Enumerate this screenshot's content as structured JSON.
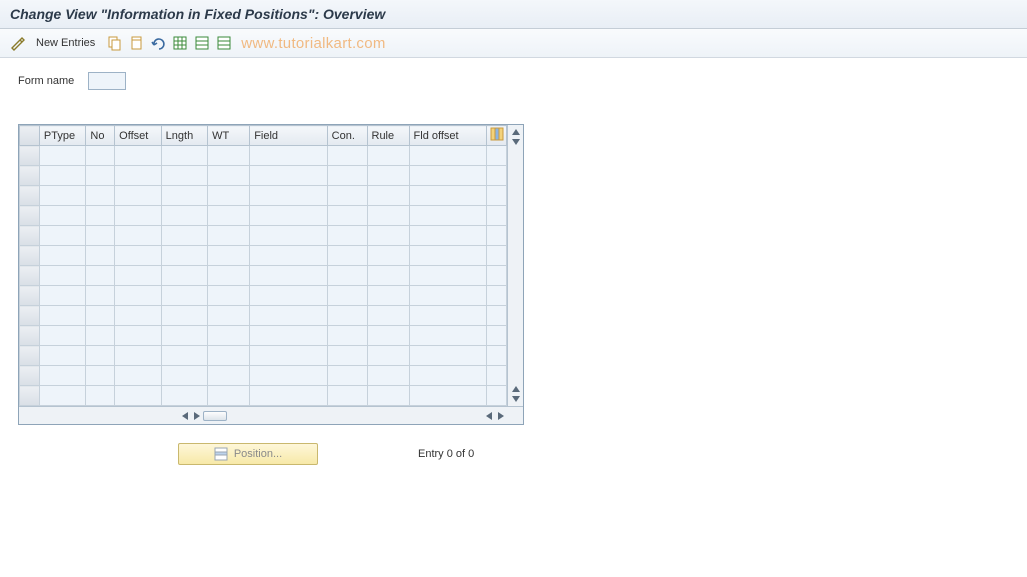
{
  "title": "Change View \"Information in Fixed Positions\": Overview",
  "toolbar": {
    "new_entries_label": "New Entries"
  },
  "watermark": "www.tutorialkart.com",
  "form": {
    "name_label": "Form name",
    "name_value": ""
  },
  "table": {
    "columns": [
      "PType",
      "No",
      "Offset",
      "Lngth",
      "WT",
      "Field",
      "Con.",
      "Rule",
      "Fld offset"
    ],
    "row_count": 13
  },
  "footer": {
    "position_label": "Position...",
    "entry_text": "Entry 0 of 0"
  }
}
